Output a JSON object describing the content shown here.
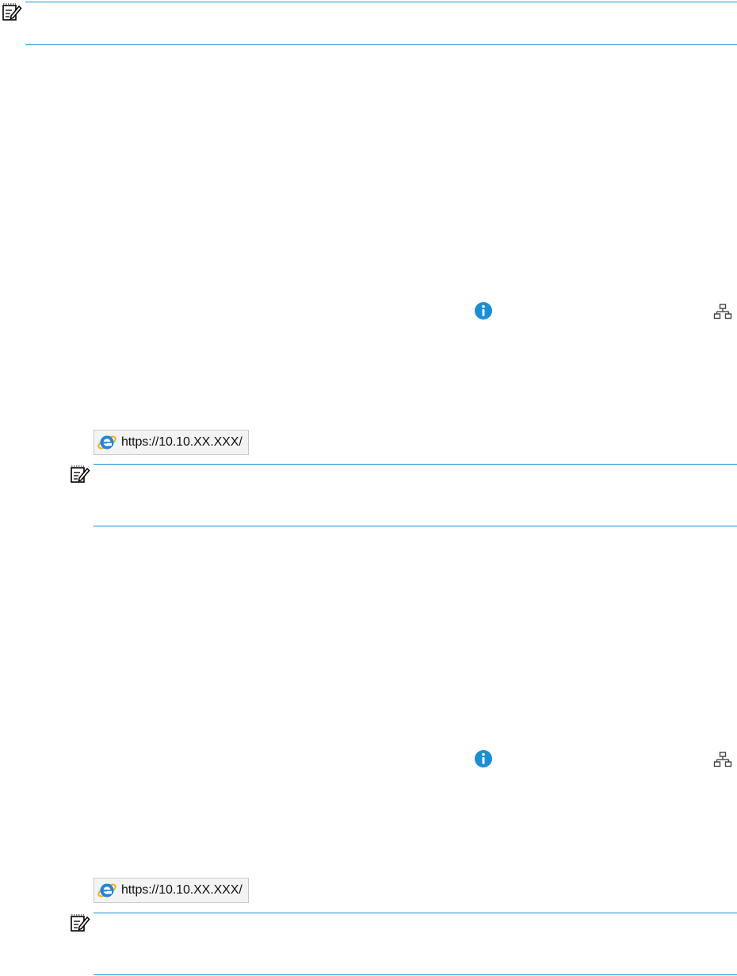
{
  "sections": [
    {
      "address_bar": {
        "url": "https://10.10.XX.XXX/"
      }
    },
    {
      "address_bar": {
        "url": "https://10.10.XX.XXX/"
      }
    }
  ],
  "colors": {
    "rule": "#1a8fd6",
    "info_icon": "#1a8fd6",
    "ie_icon": "#1e88d6"
  },
  "icons": [
    "note-icon",
    "info-icon",
    "network-icon",
    "internet-explorer-icon"
  ]
}
